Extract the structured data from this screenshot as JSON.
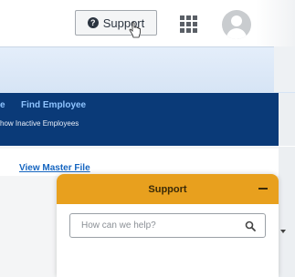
{
  "header": {
    "support_label": "Support",
    "support_icon": "question-circle-icon",
    "apps_icon": "apps-grid-icon",
    "avatar_icon": "user-avatar-icon"
  },
  "nav": {
    "partial_link": "e",
    "find_employee": "Find Employee",
    "show_inactive": "how Inactive Employees"
  },
  "content": {
    "view_master_file": "View Master File"
  },
  "support_widget": {
    "title": "Support",
    "search_placeholder": "How can we help?",
    "minimize_icon": "minus-icon",
    "search_icon": "search-icon",
    "accent_color": "#e8a01e"
  },
  "colors": {
    "navy": "#0a3a78",
    "link": "#1565c0"
  }
}
